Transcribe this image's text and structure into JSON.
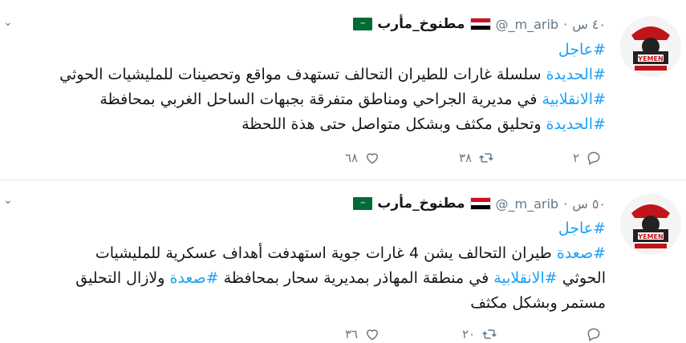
{
  "icons": {
    "more": "chevron-down-icon",
    "reply": "reply-icon",
    "retweet": "retweet-icon",
    "like": "heart-icon",
    "flag_sa": "saudi-flag-icon",
    "flag_ye": "yemen-flag-icon"
  },
  "colors": {
    "link": "#1da1f2",
    "muted": "#657786",
    "text": "#14171a"
  },
  "avatar": {
    "badge_text": "YEMEN"
  },
  "tweets": [
    {
      "name": "مطنوخ_مأرب",
      "handle": "@_m_arib",
      "time": "٤٠ س",
      "lines": [
        [
          {
            "t": "#عاجل",
            "tag": true
          }
        ],
        [
          {
            "t": "#الحديدة",
            "tag": true
          },
          {
            "t": " سلسلة غارات للطيران التحالف  تستهدف مواقع وتحصينات للمليشيات الحوثي",
            "tag": false
          }
        ],
        [
          {
            "t": "#الانقلابية",
            "tag": true
          },
          {
            "t": " في مديرية الجراحي ومناطق متفرقة بجبهات الساحل الغربي بمحافظة",
            "tag": false
          }
        ],
        [
          {
            "t": "#الحديدة",
            "tag": true
          },
          {
            "t": " وتحليق مكثف وبشكل متواصل حتى هذة اللحظة",
            "tag": false
          }
        ]
      ],
      "replies": "٢",
      "retweets": "٣٨",
      "likes": "٦٨"
    },
    {
      "name": "مطنوخ_مأرب",
      "handle": "@_m_arib",
      "time": "٥٠ س",
      "lines": [
        [
          {
            "t": "#عاجل",
            "tag": true
          }
        ],
        [
          {
            "t": "#صعدة",
            "tag": true
          },
          {
            "t": " طيران التحالف يشن 4 غارات جوية استهدفت أهداف عسكرية للمليشيات",
            "tag": false
          }
        ],
        [
          {
            "t": "الحوثي ",
            "tag": false
          },
          {
            "t": "#الانقلابية",
            "tag": true
          },
          {
            "t": " في منطقة المهاذر بمديرية سحار بمحافظة ",
            "tag": false
          },
          {
            "t": "#صعدة",
            "tag": true
          },
          {
            "t": " ولازال التحليق",
            "tag": false
          }
        ],
        [
          {
            "t": "مستمر وبشكل مكثف",
            "tag": false
          }
        ]
      ],
      "replies": "",
      "retweets": "٢٠",
      "likes": "٣٦"
    }
  ]
}
